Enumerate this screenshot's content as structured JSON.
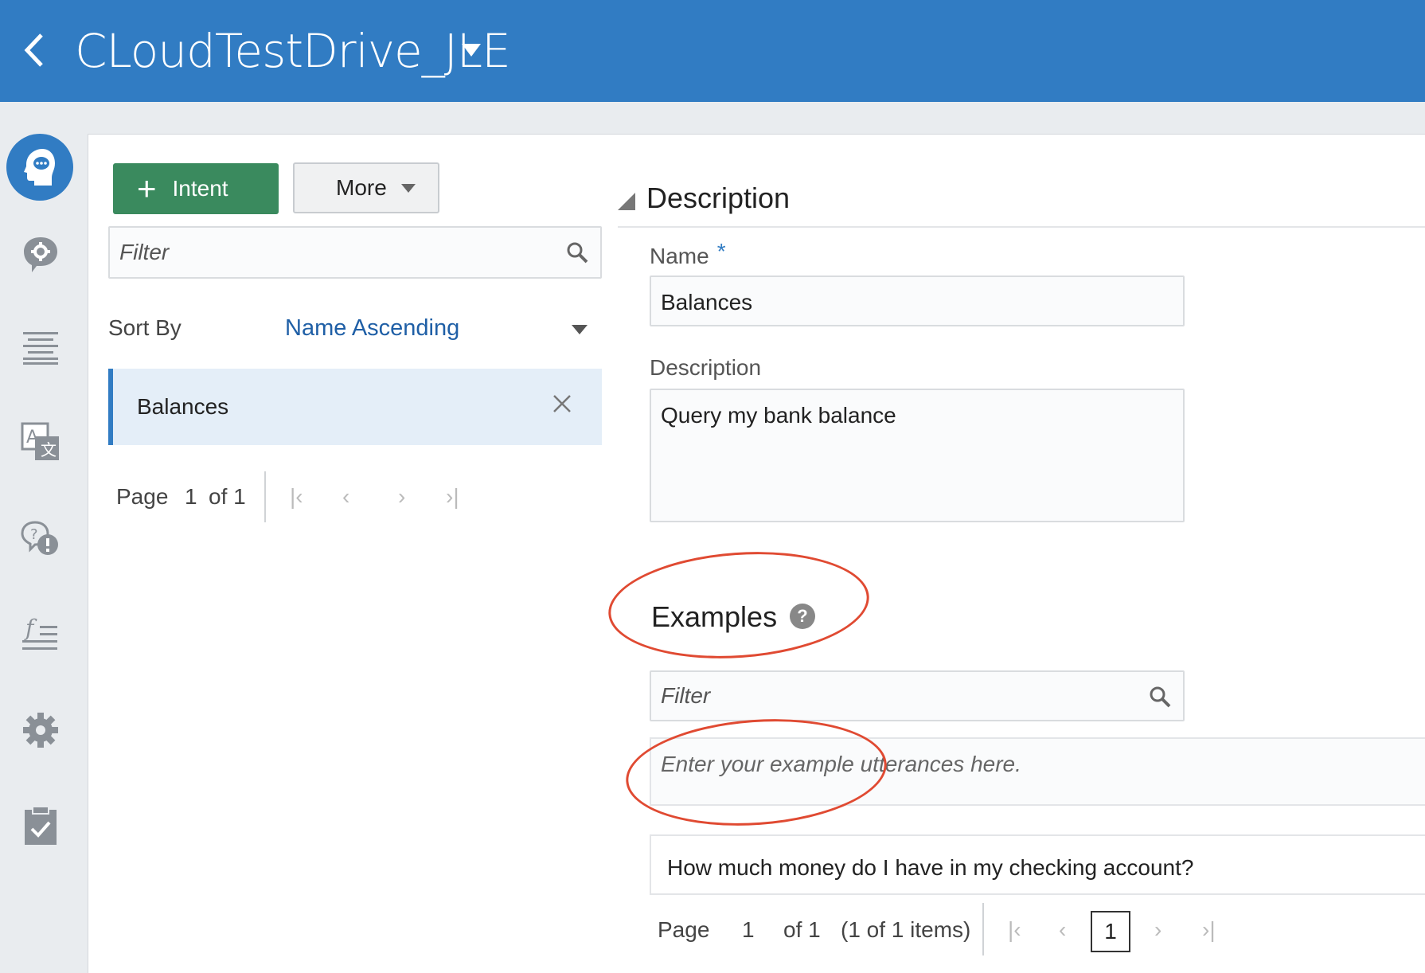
{
  "header": {
    "title": "CLoudTestDrive_JLE"
  },
  "rail": {
    "items": [
      "intents-icon",
      "entities-icon",
      "flows-icon",
      "resource-bundles-icon",
      "qna-icon",
      "components-icon",
      "settings-icon",
      "quality-icon"
    ]
  },
  "toolbar": {
    "add_intent_label": "Intent",
    "more_label": "More"
  },
  "intents_list": {
    "filter_placeholder": "Filter",
    "sort_label": "Sort By",
    "sort_value": "Name Ascending",
    "items": [
      {
        "label": "Balances"
      }
    ],
    "pager": {
      "page_label": "Page",
      "page_number": "1",
      "of_label": "of 1"
    }
  },
  "detail": {
    "section_title": "Description",
    "name_label": "Name",
    "name_required": "*",
    "name_value": "Balances",
    "description_label": "Description",
    "description_value": "Query my bank balance",
    "examples_title": "Examples",
    "examples_filter_placeholder": "Filter",
    "utterance_placeholder": "Enter your example utterances here.",
    "examples": [
      "How much money do I have in my checking account?"
    ],
    "pager": {
      "page_label": "Page",
      "page_number": "1",
      "of_label": "of 1",
      "items_label": "(1 of 1 items)",
      "current_page": "1"
    }
  },
  "colors": {
    "brand": "#317cc3",
    "primary_button": "#3a8a5e",
    "annotation": "#e04a32"
  }
}
